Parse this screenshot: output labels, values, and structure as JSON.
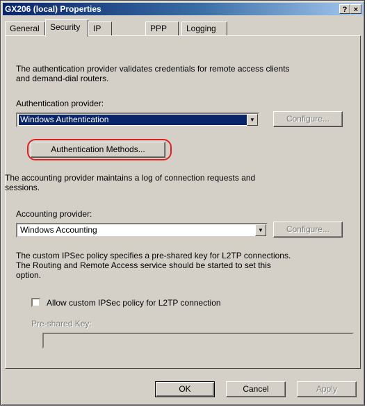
{
  "window": {
    "title": "GX206 (local) Properties",
    "help_label": "?",
    "close_label": "×"
  },
  "tabs": [
    "General",
    "Security",
    "IP",
    "PPP",
    "Logging"
  ],
  "active_tab": "Security",
  "security": {
    "auth_description": [
      "The authentication provider validates credentials for remote access clients",
      "and demand-dial routers."
    ],
    "auth_provider_label": "Authentication provider:",
    "auth_provider_value": "Windows Authentication",
    "configure_label": "Configure...",
    "auth_methods_button": "Authentication Methods...",
    "accounting_description": [
      "The accounting provider maintains a log of connection requests and",
      "sessions."
    ],
    "accounting_provider_label": "Accounting provider:",
    "accounting_provider_value": "Windows Accounting",
    "ipsec_description": [
      "The custom IPSec policy specifies a pre-shared key for L2TP connections.",
      "The Routing and Remote Access service should be started to set this",
      "option."
    ],
    "ipsec_checkbox_label": "Allow custom IPSec policy for L2TP connection",
    "ipsec_checked": false,
    "preshared_key_label": "Pre-shared Key:",
    "preshared_key_value": ""
  },
  "footer": {
    "ok": "OK",
    "cancel": "Cancel",
    "apply": "Apply"
  },
  "colors": {
    "face": "#d4d0c8",
    "title_start": "#0a246a",
    "highlight_ring": "#e02020"
  }
}
